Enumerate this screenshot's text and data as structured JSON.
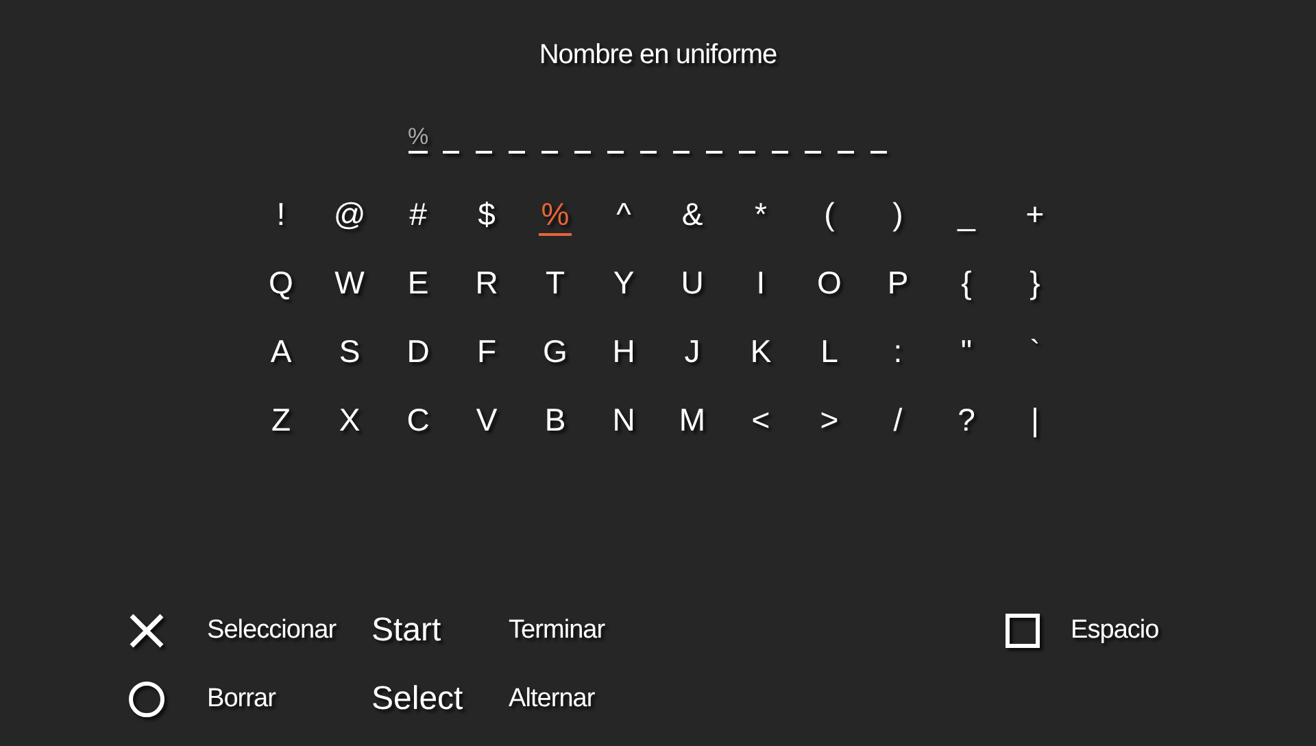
{
  "title": "Nombre en uniforme",
  "entry": {
    "value": "%"
  },
  "keyboard": [
    {
      "keys": [
        {
          "label": "!",
          "selected": false
        },
        {
          "label": "@",
          "selected": false
        },
        {
          "label": "#",
          "selected": false
        },
        {
          "label": "$",
          "selected": false
        },
        {
          "label": "%",
          "selected": true
        },
        {
          "label": "^",
          "selected": false
        },
        {
          "label": "&",
          "selected": false
        },
        {
          "label": "*",
          "selected": false
        },
        {
          "label": "(",
          "selected": false
        },
        {
          "label": ")",
          "selected": false
        },
        {
          "label": "_",
          "selected": false
        },
        {
          "label": "+",
          "selected": false
        }
      ]
    },
    {
      "keys": [
        {
          "label": "Q",
          "selected": false
        },
        {
          "label": "W",
          "selected": false
        },
        {
          "label": "E",
          "selected": false
        },
        {
          "label": "R",
          "selected": false
        },
        {
          "label": "T",
          "selected": false
        },
        {
          "label": "Y",
          "selected": false
        },
        {
          "label": "U",
          "selected": false
        },
        {
          "label": "I",
          "selected": false
        },
        {
          "label": "O",
          "selected": false
        },
        {
          "label": "P",
          "selected": false
        },
        {
          "label": "{",
          "selected": false
        },
        {
          "label": "}",
          "selected": false
        }
      ]
    },
    {
      "keys": [
        {
          "label": "A",
          "selected": false
        },
        {
          "label": "S",
          "selected": false
        },
        {
          "label": "D",
          "selected": false
        },
        {
          "label": "F",
          "selected": false
        },
        {
          "label": "G",
          "selected": false
        },
        {
          "label": "H",
          "selected": false
        },
        {
          "label": "J",
          "selected": false
        },
        {
          "label": "K",
          "selected": false
        },
        {
          "label": "L",
          "selected": false
        },
        {
          "label": ":",
          "selected": false
        },
        {
          "label": "\"",
          "selected": false
        },
        {
          "label": "`",
          "selected": false
        }
      ]
    },
    {
      "keys": [
        {
          "label": "Z",
          "selected": false
        },
        {
          "label": "X",
          "selected": false
        },
        {
          "label": "C",
          "selected": false
        },
        {
          "label": "V",
          "selected": false
        },
        {
          "label": "B",
          "selected": false
        },
        {
          "label": "N",
          "selected": false
        },
        {
          "label": "M",
          "selected": false
        },
        {
          "label": "<",
          "selected": false
        },
        {
          "label": ">",
          "selected": false
        },
        {
          "label": "/",
          "selected": false
        },
        {
          "label": "?",
          "selected": false
        },
        {
          "label": "|",
          "selected": false
        }
      ]
    }
  ],
  "legend_rows": [
    {
      "items": [
        {
          "kind": "cross",
          "action": "Seleccionar"
        },
        {
          "kind": "button",
          "button": "Start",
          "action": "Terminar"
        },
        {
          "kind": "square",
          "action": "Espacio"
        }
      ]
    },
    {
      "items": [
        {
          "kind": "circle",
          "action": "Borrar"
        },
        {
          "kind": "button",
          "button": "Select",
          "action": "Alternar"
        }
      ]
    }
  ]
}
